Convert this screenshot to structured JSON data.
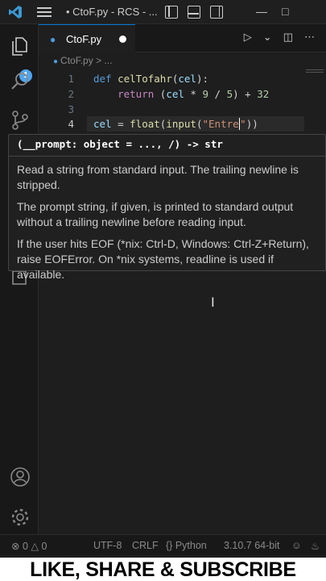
{
  "titlebar": {
    "title": "• CtoF.py - RCS - ..."
  },
  "activity": {
    "badge_count": "1"
  },
  "tab": {
    "label": "CtoF.py",
    "icon": "python-icon"
  },
  "breadcrumb": {
    "file": "CtoF.py",
    "rest": "> ..."
  },
  "editor": {
    "lines": [
      {
        "number": "1",
        "parts": [
          [
            "kw",
            "def "
          ],
          [
            "fn",
            "celTofahr"
          ],
          [
            "op",
            "("
          ],
          [
            "var",
            "cel"
          ],
          [
            "op",
            "):"
          ]
        ]
      },
      {
        "number": "2",
        "parts": [
          [
            "op",
            "    "
          ],
          [
            "kw2",
            "return"
          ],
          [
            "op",
            " ("
          ],
          [
            "var",
            "cel"
          ],
          [
            "op",
            " * "
          ],
          [
            "num",
            "9"
          ],
          [
            "op",
            " / "
          ],
          [
            "num",
            "5"
          ],
          [
            "op",
            ") + "
          ],
          [
            "num",
            "32"
          ]
        ]
      },
      {
        "number": "3",
        "parts": []
      },
      {
        "number": "4",
        "parts": [
          [
            "var",
            "cel"
          ],
          [
            "op",
            " = "
          ],
          [
            "fn",
            "float"
          ],
          [
            "op",
            "("
          ],
          [
            "fn",
            "input"
          ],
          [
            "op",
            "("
          ],
          [
            "str",
            "\"Entre"
          ],
          [
            "caret",
            ""
          ],
          [
            "str",
            "\""
          ],
          [
            "op",
            "))"
          ]
        ]
      }
    ]
  },
  "popup": {
    "signature": "(__prompt: object = ..., /) -> str",
    "paragraphs": [
      "Read a string from standard input. The trailing newline is stripped.",
      "The prompt string, if given, is printed to standard output without a trailing newline before reading input.",
      "If the user hits EOF (*nix: Ctrl-D, Windows: Ctrl-Z+Return), raise EOFError. On *nix systems, readline is used if available."
    ]
  },
  "statusbar": {
    "errors": "0",
    "warnings": "0",
    "encoding": "UTF-8",
    "eol": "CRLF",
    "language": "Python",
    "interpreter": "3.10.7 64-bit"
  },
  "banner": {
    "text": "LIKE, SHARE & SUBSCRIBE"
  },
  "colors": {
    "accent": "#0078d4",
    "badge": "#4fa5ee",
    "keyword": "#569cd6",
    "function": "#dcdcaa",
    "string": "#ce9178",
    "number": "#b5cea8"
  }
}
